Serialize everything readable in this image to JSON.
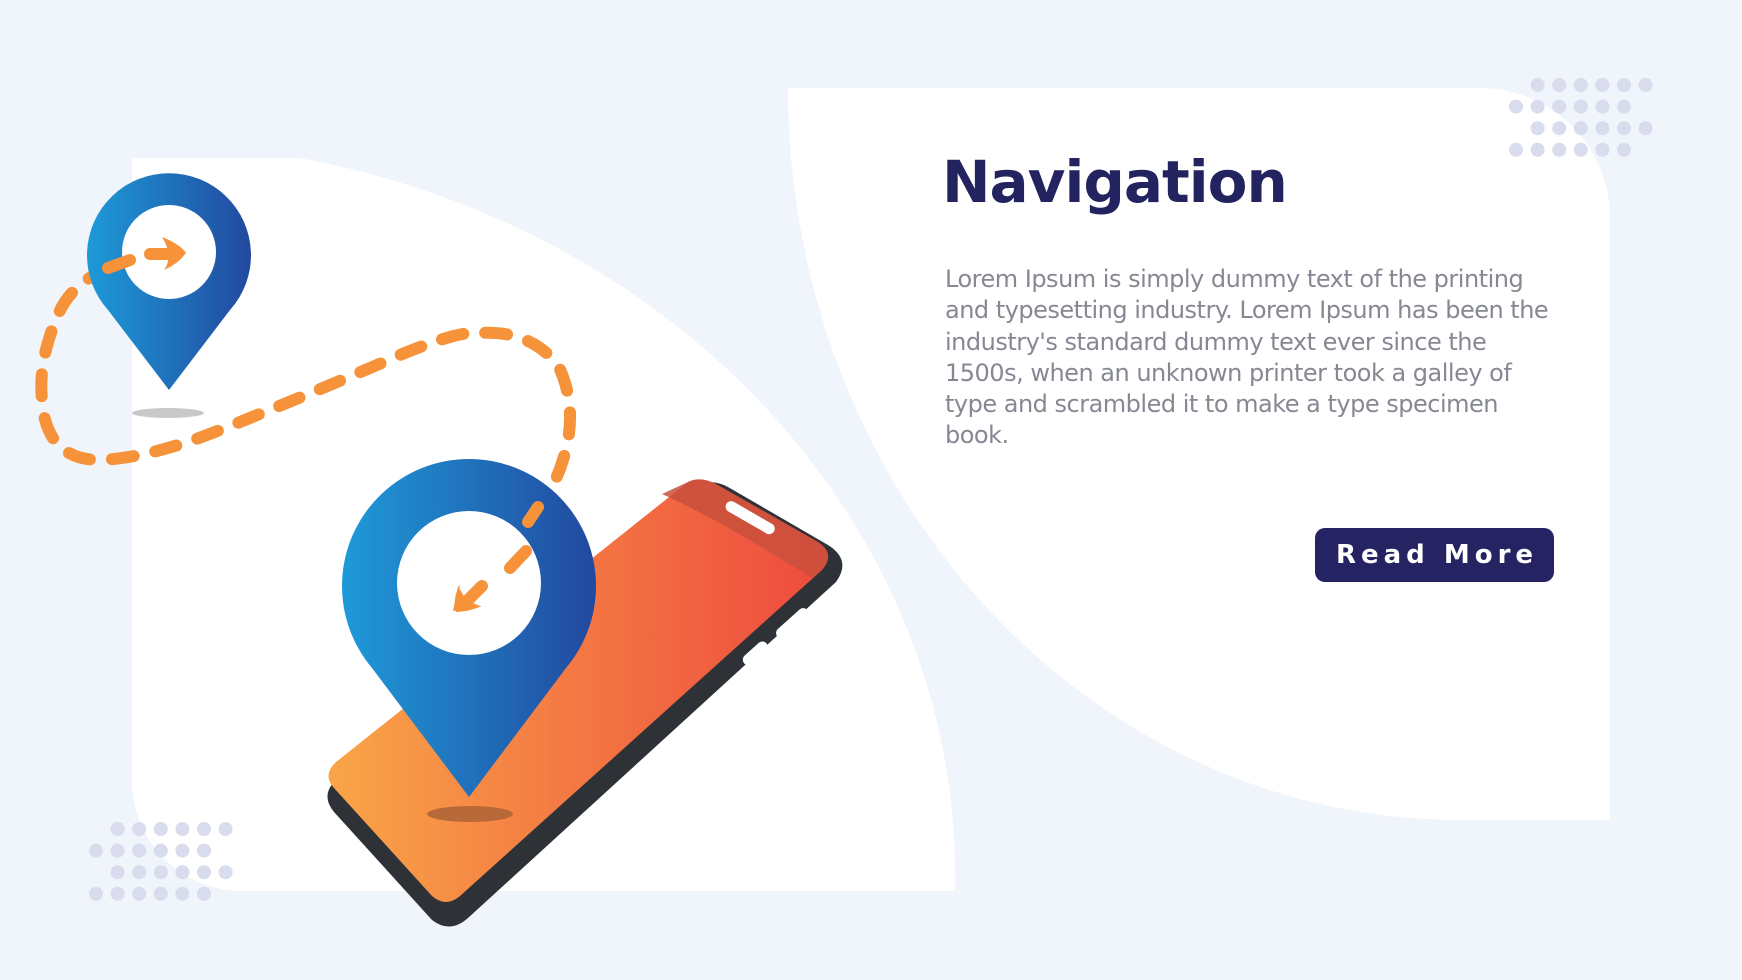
{
  "banner": {
    "title": "Navigation",
    "body": "Lorem Ipsum is simply dummy text of the printing and typesetting industry. Lorem Ipsum has been the industry's standard dummy text ever since the 1500s, when an unknown printer took a galley of type and scrambled it to make a type specimen book.",
    "cta_label": "Read More"
  },
  "illustration": {
    "icons": [
      "location-pin-icon",
      "location-pin-icon",
      "smartphone-icon",
      "arrow-right-icon",
      "arrow-down-left-icon",
      "dot-grid-pattern"
    ]
  },
  "colors": {
    "background": "#f0f4fb",
    "panel": "#ffffff",
    "title": "#22235f",
    "body_text": "#868893",
    "button": "#252362",
    "button_text": "#ffffff",
    "pin_gradient_start": "#1e9ad8",
    "pin_gradient_end": "#22499f",
    "route_dash": "#f5923a",
    "phone_gradient_start": "#f9a548",
    "phone_gradient_end": "#ee4a3e",
    "phone_body": "#2e3236",
    "dots": "#d8dcec"
  }
}
